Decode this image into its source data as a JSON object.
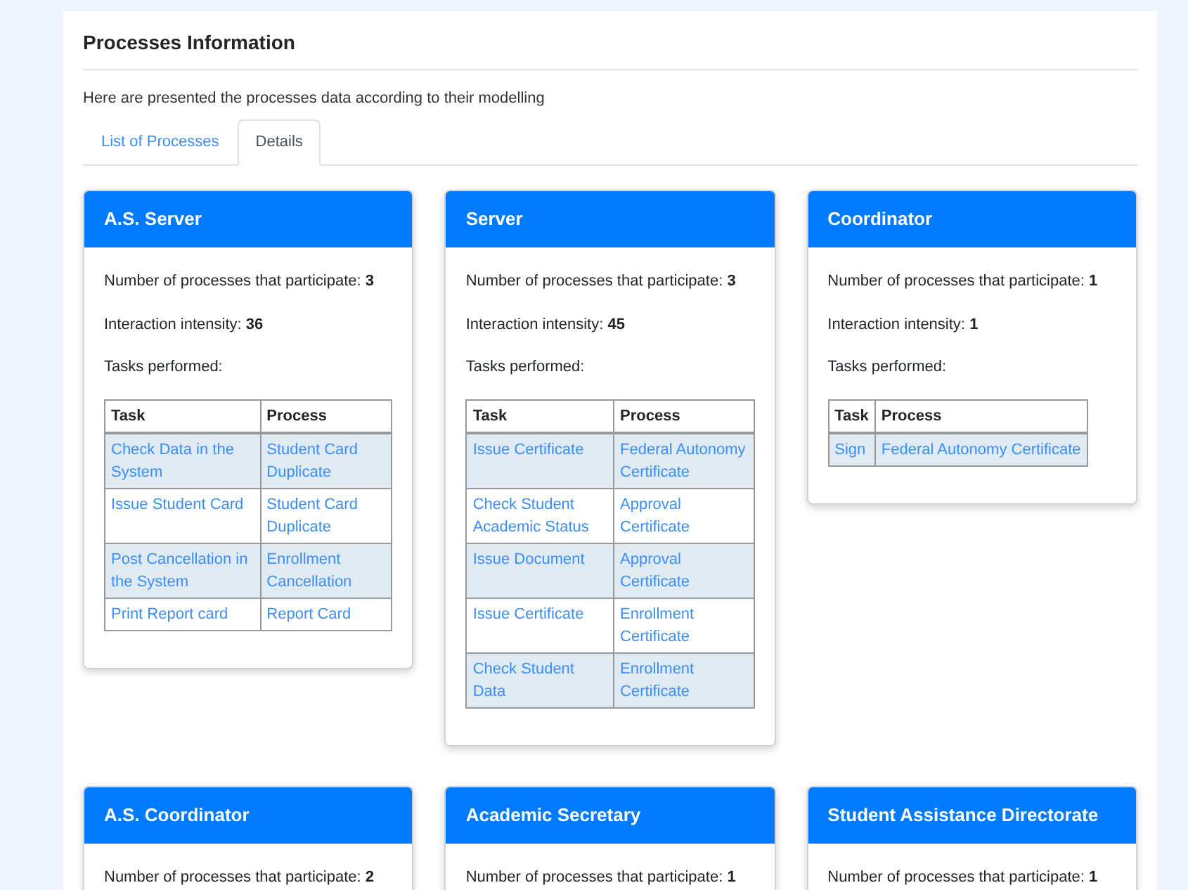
{
  "title": "Processes Information",
  "description": "Here are presented the processes data according to their modelling",
  "tabs": [
    {
      "label": "List of Processes",
      "selected": false
    },
    {
      "label": "Details",
      "selected": true
    }
  ],
  "cards": [
    {
      "title": "A.S. Server",
      "participate_label": "Number of processes that participate:",
      "participate": "3",
      "intensity_label": "Interaction intensity:",
      "intensity": "36",
      "tasks_label": "Tasks performed:",
      "columns": [
        "Task",
        "Process"
      ],
      "rows": [
        {
          "task": "Check Data in the System",
          "process": "Student Card Duplicate"
        },
        {
          "task": "Issue Student Card",
          "process": "Student Card Duplicate"
        },
        {
          "task": "Post Cancellation in the System",
          "process": "Enrollment Cancellation"
        },
        {
          "task": "Print Report card",
          "process": "Report Card"
        }
      ]
    },
    {
      "title": "Server",
      "participate_label": "Number of processes that participate:",
      "participate": "3",
      "intensity_label": "Interaction intensity:",
      "intensity": "45",
      "tasks_label": "Tasks performed:",
      "columns": [
        "Task",
        "Process"
      ],
      "rows": [
        {
          "task": "Issue Certificate",
          "process": "Federal Autonomy Certificate"
        },
        {
          "task": "Check Student Academic Status",
          "process": "Approval Certificate"
        },
        {
          "task": "Issue Document",
          "process": "Approval Certificate"
        },
        {
          "task": "Issue Certificate",
          "process": "Enrollment Certificate"
        },
        {
          "task": "Check Student Data",
          "process": "Enrollment Certificate"
        }
      ]
    },
    {
      "title": "Coordinator",
      "participate_label": "Number of processes that participate:",
      "participate": "1",
      "intensity_label": "Interaction intensity:",
      "intensity": "1",
      "tasks_label": "Tasks performed:",
      "columns": [
        "Task",
        "Process"
      ],
      "rows": [
        {
          "task": "Sign",
          "process": "Federal Autonomy Certificate"
        }
      ]
    },
    {
      "title": "A.S. Coordinator",
      "participate_label": "Number of processes that participate:",
      "participate": "2"
    },
    {
      "title": "Academic Secretary",
      "participate_label": "Number of processes that participate:",
      "participate": "1"
    },
    {
      "title": "Student Assistance Directorate",
      "participate_label": "Number of processes that participate:",
      "participate": "1"
    }
  ]
}
